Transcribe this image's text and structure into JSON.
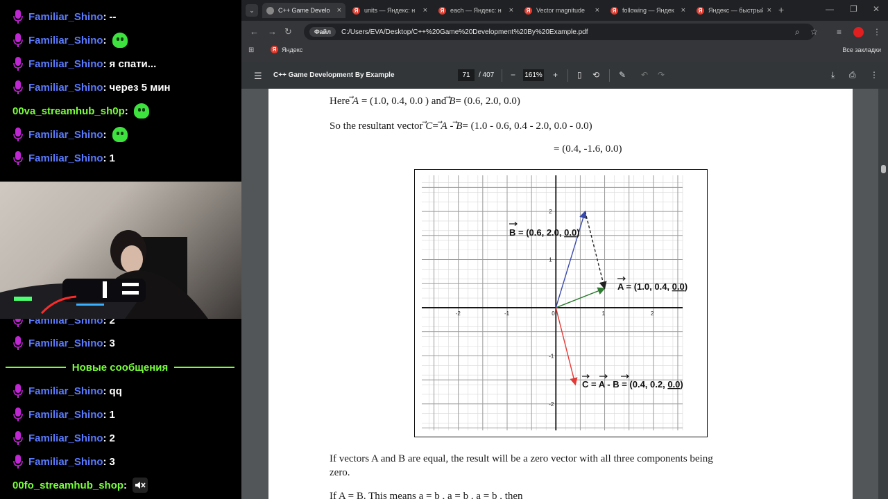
{
  "chat": {
    "messages": [
      {
        "user": "Familiar_Shino",
        "text": "--",
        "emote": false,
        "top": 12
      },
      {
        "user": "Familiar_Shino",
        "text": "",
        "emote": true,
        "top": 46
      },
      {
        "user": "Familiar_Shino",
        "text": "я спати...",
        "emote": false,
        "top": 80
      },
      {
        "user": "Familiar_Shino",
        "text": "через 5 мин",
        "emote": false,
        "top": 114
      },
      {
        "user": "00va_streamhub_sh0p",
        "text": "",
        "emote": true,
        "top": 148,
        "green": true,
        "nomic": true
      },
      {
        "user": "Familiar_Shino",
        "text": "",
        "emote": true,
        "top": 182
      },
      {
        "user": "Familiar_Shino",
        "text": "1",
        "emote": false,
        "top": 216
      },
      {
        "user": "Familiar_Shino",
        "text": "2",
        "emote": false,
        "top": 450
      },
      {
        "user": "Familiar_Shino",
        "text": "3",
        "emote": false,
        "top": 483
      }
    ],
    "new_messages_label": "Новые сообщения",
    "new_messages": [
      {
        "user": "Familiar_Shino",
        "text": "qq",
        "top": 552
      },
      {
        "user": "Familiar_Shino",
        "text": "1",
        "top": 586
      },
      {
        "user": "Familiar_Shino",
        "text": "2",
        "top": 620
      },
      {
        "user": "Familiar_Shino",
        "text": "3",
        "top": 654
      }
    ],
    "last_message": {
      "user": "00fo_streamhub_shop",
      "text": ""
    }
  },
  "browser": {
    "tabs": [
      {
        "title": "C++ Game Develo",
        "icon": "globe-icon",
        "active": true
      },
      {
        "title": "units — Яндекс: н",
        "icon": "yandex-icon",
        "active": false
      },
      {
        "title": "each — Яндекс: н",
        "icon": "yandex-icon",
        "active": false
      },
      {
        "title": "Vector magnitude",
        "icon": "yandex-icon",
        "active": false
      },
      {
        "title": "following — Яндек",
        "icon": "yandex-icon",
        "active": false
      },
      {
        "title": "Яндекс — быстрый",
        "icon": "yandex-icon",
        "active": false
      }
    ],
    "address_chip": "Файл",
    "url": "C:/Users/EVA/Desktop/C++%20Game%20Development%20By%20Example.pdf",
    "bookmark": "Яндекс",
    "all_bookmarks": "Все закладки",
    "yandex_glyph": "Я"
  },
  "pdf": {
    "title": "C++ Game Development By Example",
    "page": "71",
    "total": "/ 407",
    "zoom": "161%",
    "line1": {
      "pre": "Here ",
      "a": "A",
      "mid1": " = (1.0, 0.4, 0.0 ) and ",
      "b": "B",
      "mid2": "= (0.6, 2.0, 0.0)"
    },
    "line2": {
      "pre": "So the resultant vector ",
      "c": "C",
      "eq": "= ",
      "a": "A",
      "minus": " - ",
      "b": "B",
      "post": "= (1.0 - 0.6, 0.4 - 2.0, 0.0 - 0.0)"
    },
    "line3": "= (0.4, -1.6, 0.0)",
    "para1": "If vectors A and B are equal, the result will be a zero vector with all three components being",
    "para1b": "zero.",
    "para2": "If  A = B. This means a  = b , a  = b , a  = b , then"
  },
  "chart_data": {
    "type": "scatter",
    "title": "",
    "xlim": [
      -2.75,
      2.6
    ],
    "ylim": [
      -2.55,
      2.75
    ],
    "x_ticks": [
      "-2",
      "-1",
      "0",
      "1",
      "2"
    ],
    "y_ticks": [
      "2",
      "1",
      "-1",
      "-2"
    ],
    "vectors": [
      {
        "name": "A",
        "from": [
          0,
          0
        ],
        "to": [
          1.0,
          0.4
        ],
        "color": "#2e7d32",
        "label": "A = (1.0, 0.4, 0.0)"
      },
      {
        "name": "B",
        "from": [
          0,
          0
        ],
        "to": [
          0.6,
          2.0
        ],
        "color": "#3949ab",
        "label": "B = (0.6, 2.0, 0.0)"
      },
      {
        "name": "C",
        "from": [
          0,
          0
        ],
        "to": [
          0.4,
          -1.6
        ],
        "color": "#e53935",
        "label": "C = A - B = (0.4, 0.2, 0.0)"
      },
      {
        "name": "B-to-A",
        "from": [
          0.6,
          2.0
        ],
        "to": [
          1.0,
          0.4
        ],
        "color": "#222222",
        "dashed": true,
        "label": ""
      }
    ],
    "labels": {
      "B": {
        "sym": "B",
        "rest": " = (0.6, 2.0, ",
        "und": "0.0",
        "end": ")"
      },
      "A": {
        "sym": "A",
        "rest": " = (1.0, 0.4, ",
        "und": "0.0",
        "end": ")"
      },
      "C": {
        "sym": "C",
        "eq1": " = ",
        "a": "A",
        "minus": " - ",
        "b": "B",
        "rest": " = (0.4, 0.2, ",
        "und": "0.0",
        "end": ")"
      }
    },
    "grid": true
  }
}
